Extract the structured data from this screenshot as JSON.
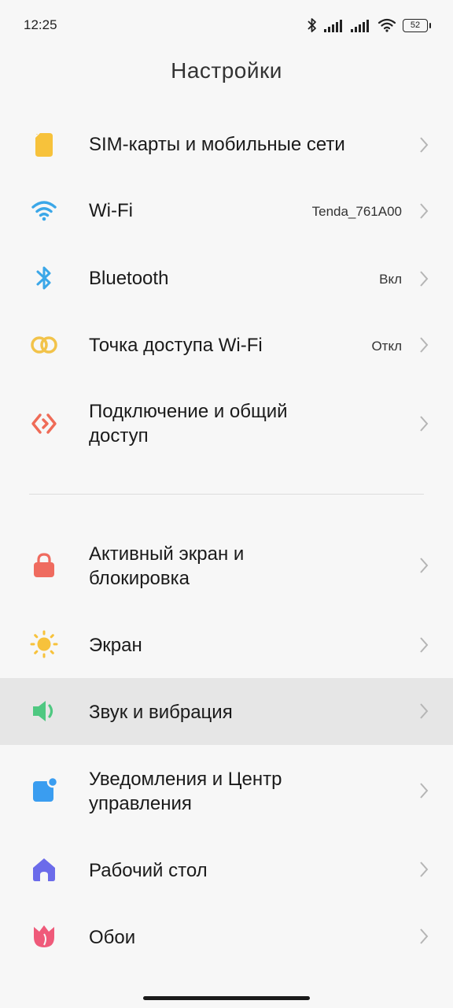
{
  "status_bar": {
    "time": "12:25",
    "battery": "52"
  },
  "header": {
    "title": "Настройки"
  },
  "items": [
    {
      "label": "SIM-карты и мобильные сети",
      "value": ""
    },
    {
      "label": "Wi-Fi",
      "value": "Tenda_761A00"
    },
    {
      "label": "Bluetooth",
      "value": "Вкл"
    },
    {
      "label": "Точка доступа Wi-Fi",
      "value": "Откл"
    },
    {
      "label_line1": "Подключение и общий",
      "label_line2": "доступ"
    },
    {
      "label_line1": "Активный экран и",
      "label_line2": "блокировка"
    },
    {
      "label": "Экран"
    },
    {
      "label": "Звук и вибрация"
    },
    {
      "label_line1": "Уведомления и Центр",
      "label_line2": "управления"
    },
    {
      "label": "Рабочий стол"
    },
    {
      "label": "Обои"
    }
  ],
  "icons": {
    "sim": "sim-card-icon",
    "wifi": "wifi-icon",
    "bluetooth": "bluetooth-icon",
    "hotspot": "hotspot-icon",
    "connection": "connection-sharing-icon",
    "lock": "lock-icon",
    "display": "sun-icon",
    "sound": "speaker-icon",
    "notifications": "notification-icon",
    "home": "home-icon",
    "wallpaper": "tulip-icon"
  },
  "colors": {
    "sim": "#f7c23b",
    "wifi": "#3ba7e8",
    "bluetooth": "#3ba7e8",
    "hotspot": "#f2c34a",
    "connection": "#ef6b57",
    "lock": "#ef6b5f",
    "display": "#f7c23b",
    "sound": "#4fc881",
    "notifications": "#3a9df0",
    "home": "#6b6bea",
    "wallpaper": "#ef5a7a",
    "highlight": "#e6e6e6"
  }
}
